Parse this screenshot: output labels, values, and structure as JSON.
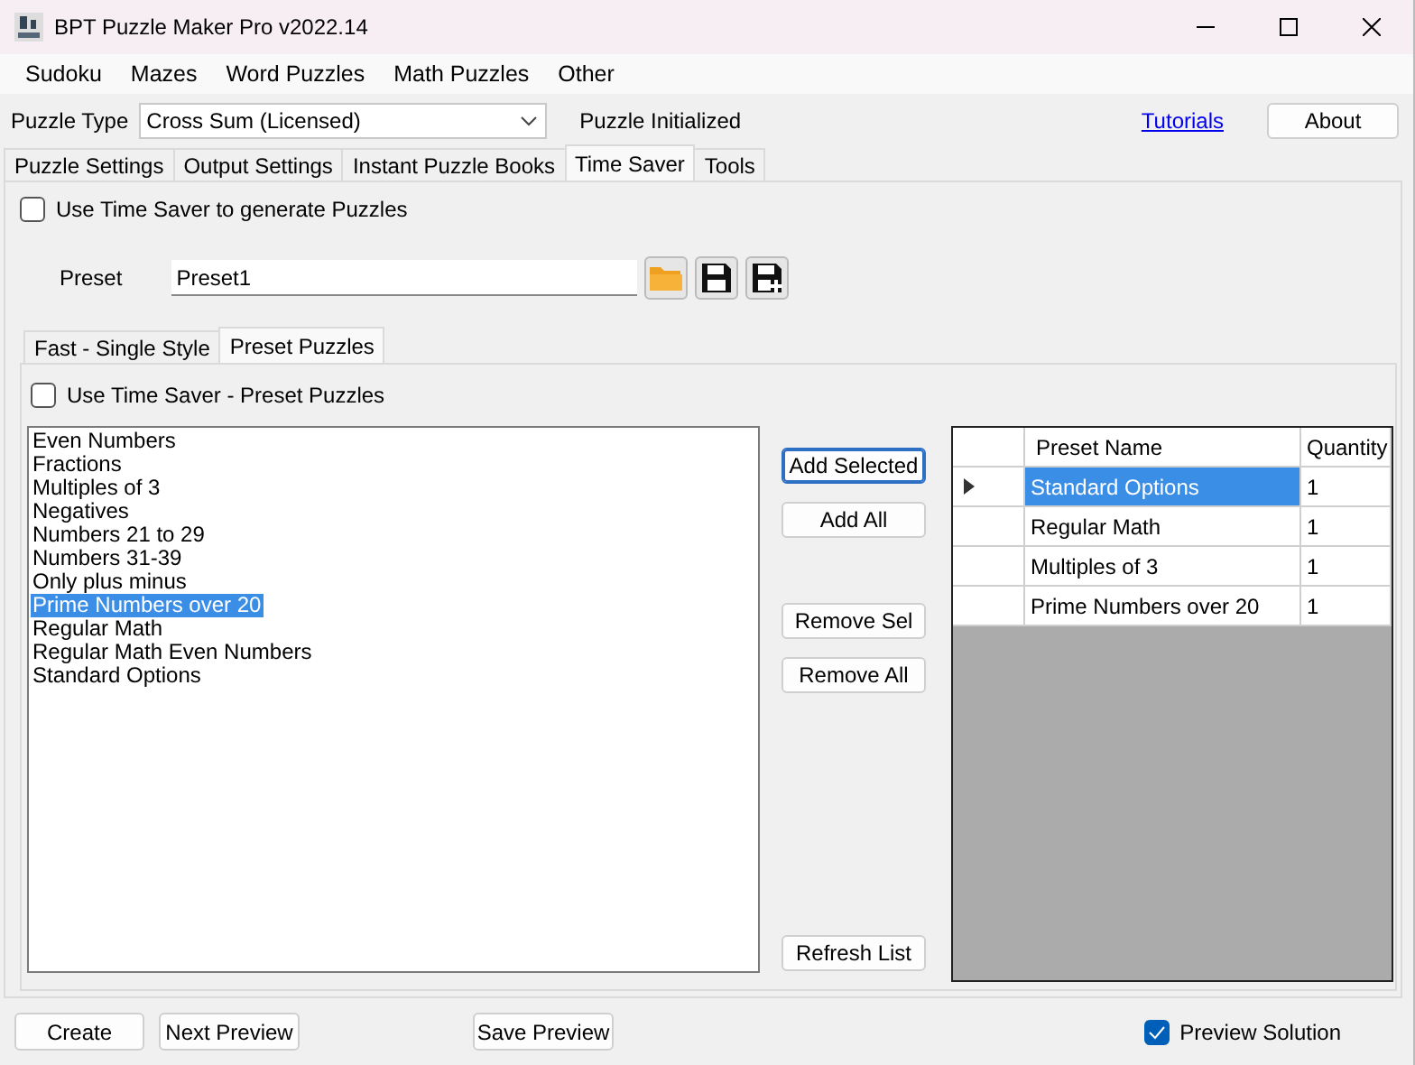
{
  "window": {
    "title": "BPT Puzzle Maker Pro v2022.14"
  },
  "menu": [
    "Sudoku",
    "Mazes",
    "Word Puzzles",
    "Math Puzzles",
    "Other"
  ],
  "puzzle_type": {
    "label": "Puzzle Type",
    "value": "Cross Sum (Licensed)",
    "status": "Puzzle Initialized",
    "link": "Tutorials",
    "button": "About"
  },
  "tabs": [
    {
      "label": "Puzzle Settings",
      "selected": false
    },
    {
      "label": "Output Settings",
      "selected": false
    },
    {
      "label": "Instant Puzzle Books",
      "selected": false
    },
    {
      "label": "Time Saver",
      "selected": true
    },
    {
      "label": "Tools",
      "selected": false
    }
  ],
  "use_time_saver": {
    "label": "Use Time Saver to generate Puzzles",
    "checked": false
  },
  "preset": {
    "label": "Preset",
    "value": "Preset1"
  },
  "inner_tabs": [
    {
      "label": "Fast - Single Style",
      "selected": false
    },
    {
      "label": "Preset Puzzles",
      "selected": true
    }
  ],
  "use_preset": {
    "label": "Use Time Saver - Preset Puzzles",
    "checked": false
  },
  "preset_list": [
    {
      "label": "Even Numbers",
      "selected": false
    },
    {
      "label": "Fractions",
      "selected": false
    },
    {
      "label": "Multiples of 3",
      "selected": false
    },
    {
      "label": "Negatives",
      "selected": false
    },
    {
      "label": "Numbers 21 to 29",
      "selected": false
    },
    {
      "label": "Numbers 31-39",
      "selected": false
    },
    {
      "label": "Only plus minus",
      "selected": false
    },
    {
      "label": "Prime Numbers over 20",
      "selected": true
    },
    {
      "label": "Regular Math",
      "selected": false
    },
    {
      "label": "Regular Math Even Numbers",
      "selected": false
    },
    {
      "label": "Standard Options",
      "selected": false
    }
  ],
  "list_buttons": [
    {
      "label": "Add Selected",
      "focused": true
    },
    {
      "label": "Add All",
      "focused": false
    },
    {
      "label": "Remove Sel",
      "focused": false
    },
    {
      "label": "Remove All",
      "focused": false
    },
    {
      "label": "Refresh List",
      "focused": false
    }
  ],
  "grid": {
    "columns": [
      "Preset Name",
      "Quantity"
    ],
    "rows": [
      {
        "name": "Standard Options",
        "quantity": "1",
        "selected": true
      },
      {
        "name": "Regular Math",
        "quantity": "1",
        "selected": false
      },
      {
        "name": "Multiples of 3",
        "quantity": "1",
        "selected": false
      },
      {
        "name": "Prime Numbers over 20",
        "quantity": "1",
        "selected": false
      }
    ]
  },
  "bottom_buttons": [
    "Create",
    "Next Preview",
    "Save Preview"
  ],
  "preview_solution": {
    "label": "Preview Solution",
    "checked": true
  }
}
